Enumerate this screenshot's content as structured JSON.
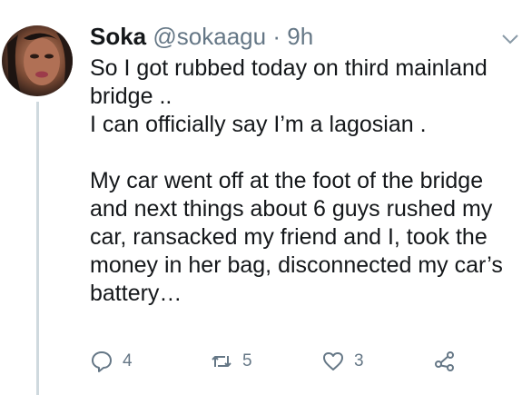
{
  "tweet": {
    "author_name": "Soka",
    "author_handle": "@sokaagu",
    "separator": "·",
    "time": "9h",
    "lines_block1": [
      "So I got rubbed today on third mainland",
      "bridge ..",
      "I can officially say I’m a  lagosian ."
    ],
    "lines_block2": [
      "My car went off at the foot of the bridge",
      "and next things about 6 guys rushed my",
      "car, ransacked my friend and I, took the",
      "money in her bag, disconnected my car’s",
      "battery…"
    ]
  },
  "actions": {
    "reply_count": "4",
    "retweet_count": "5",
    "like_count": "3",
    "reply_icon": "reply-icon",
    "retweet_icon": "retweet-icon",
    "like_icon": "heart-icon",
    "share_icon": "share-icon"
  },
  "colors": {
    "text": "#14171a",
    "secondary": "#657786",
    "thread_line": "#cfd9de"
  }
}
